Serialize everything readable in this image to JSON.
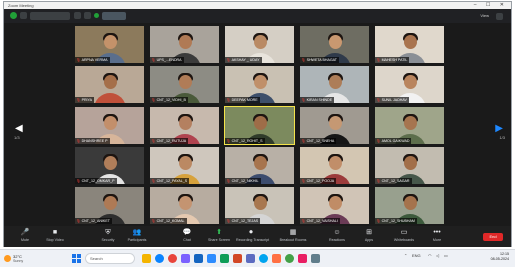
{
  "window": {
    "title": "Zoom Meeting",
    "controls": "–  ☐  ✕"
  },
  "top_bar": {
    "view_label": "View"
  },
  "pager": {
    "left_page": "1/3",
    "right_page": "1/3"
  },
  "tiles": [
    {
      "name": "ARPNA VERMA",
      "bg": "#8c7a5c",
      "skin": "#c4926a",
      "shirt": "#5a6e8c",
      "active": false
    },
    {
      "name": "UPS_...ENDRA",
      "bg": "#a9a39b",
      "skin": "#b07a55",
      "shirt": "#3b3b3b",
      "active": false
    },
    {
      "name": "AKSHAY _ UDAY",
      "bg": "#d5cfc5",
      "skin": "#b98a64",
      "shirt": "#e8e4dc",
      "active": false
    },
    {
      "name": "SHWETA BHAGAT",
      "bg": "#6e6d62",
      "skin": "#c99870",
      "shirt": "#2f3a4a",
      "active": false
    },
    {
      "name": "MAHESH PATIL",
      "bg": "#e0d8cc",
      "skin": "#a9744f",
      "shirt": "#8a8f96",
      "active": false
    },
    {
      "name": "PRIYA",
      "bg": "#b9a896",
      "skin": "#a56f4a",
      "shirt": "#c0503a",
      "active": false
    },
    {
      "name": "CNT_12_VIDHI_B",
      "bg": "#8d8c84",
      "skin": "#b07c57",
      "shirt": "#4a5a3a",
      "active": false
    },
    {
      "name": "DEEPAK MORE",
      "bg": "#c9c1b3",
      "skin": "#c0906a",
      "shirt": "#3d4f6b",
      "active": false
    },
    {
      "name": "KIRAN SHINDE",
      "bg": "#aeb5b8",
      "skin": "#ad7d58",
      "shirt": "#e6e6e6",
      "active": false
    },
    {
      "name": "SUNIL JADHAV",
      "bg": "#ddd6cb",
      "skin": "#b9855e",
      "shirt": "#f2f2f2",
      "active": false
    },
    {
      "name": "DHANSHREE P",
      "bg": "#b6a39a",
      "skin": "#c38f6b",
      "shirt": "#d7b59a",
      "active": false
    },
    {
      "name": "CNT_12_RUTUJA",
      "bg": "#c7b9ad",
      "skin": "#b48060",
      "shirt": "#b0434f",
      "active": false
    },
    {
      "name": "CNT_12_ROHIT_S",
      "bg": "#7c8a5e",
      "skin": "#9e6d48",
      "shirt": "#2f3b2a",
      "active": true
    },
    {
      "name": "CNT_12_SNEHA",
      "bg": "#a09a91",
      "skin": "#c59873",
      "shirt": "#161616",
      "active": false
    },
    {
      "name": "AMOL GAIKWAD",
      "bg": "#9fa58a",
      "skin": "#a6754f",
      "shirt": "#5d6e4c",
      "active": false
    },
    {
      "name": "CNT_12_OMKAR_P",
      "bg": "#3a3a3a",
      "skin": "#b07e5a",
      "shirt": "#e4e4e4",
      "active": false
    },
    {
      "name": "CNT_12_PAYAL_S",
      "bg": "#cfc7bd",
      "skin": "#bb8963",
      "shirt": "#d7a23c",
      "active": false
    },
    {
      "name": "CNT_12_NIKHIL",
      "bg": "#b8b0a6",
      "skin": "#a7744d",
      "shirt": "#3c4c6e",
      "active": false
    },
    {
      "name": "CNT_12_POOJA",
      "bg": "#d3c6b2",
      "skin": "#c18e69",
      "shirt": "#9c3b3b",
      "active": false
    },
    {
      "name": "CNT_12_SAGAR",
      "bg": "#c2bcb0",
      "skin": "#a26f49",
      "shirt": "#46574a",
      "active": false
    },
    {
      "name": "CNT_12_ANIKET",
      "bg": "#8a857c",
      "skin": "#ae7a55",
      "shirt": "#2e2e2e",
      "active": false
    },
    {
      "name": "CNT_12_KOMAL",
      "bg": "#b7aca0",
      "skin": "#c49471",
      "shirt": "#e5c9b0",
      "active": false
    },
    {
      "name": "CNT_12_TEJAS",
      "bg": "#c9c3b8",
      "skin": "#a8774f",
      "shirt": "#d5d5d5",
      "active": false
    },
    {
      "name": "CNT_12_VAISHALI",
      "bg": "#d0c4b6",
      "skin": "#c08c66",
      "shirt": "#6b3b56",
      "active": false
    },
    {
      "name": "CNT_12_SHUBHAM",
      "bg": "#98a08e",
      "skin": "#a5734d",
      "shirt": "#3c5a3c",
      "active": false
    }
  ],
  "controls": [
    {
      "label": "Mute",
      "icon": "🎤",
      "name": "mute-button"
    },
    {
      "label": "Stop Video",
      "icon": "■",
      "name": "stop-video-button"
    },
    {
      "label": "Security",
      "icon": "⛨",
      "name": "security-button"
    },
    {
      "label": "Participants",
      "icon": "👥",
      "name": "participants-button"
    },
    {
      "label": "Chat",
      "icon": "💬",
      "name": "chat-button"
    },
    {
      "label": "Share Screen",
      "icon": "⬆",
      "name": "share-screen-button"
    },
    {
      "label": "Recording Transcript",
      "icon": "⏺",
      "name": "record-button"
    },
    {
      "label": "Breakout Rooms",
      "icon": "▦",
      "name": "breakout-rooms-button"
    },
    {
      "label": "Reactions",
      "icon": "☺",
      "name": "reactions-button"
    },
    {
      "label": "Apps",
      "icon": "⊞",
      "name": "apps-button"
    },
    {
      "label": "Whiteboards",
      "icon": "▭",
      "name": "whiteboards-button"
    },
    {
      "label": "More",
      "icon": "•••",
      "name": "more-button"
    }
  ],
  "end_label": "End",
  "taskbar": {
    "weather_temp": "32°C",
    "weather_text": "Sunny",
    "search_placeholder": "Search",
    "lang": "ENG",
    "time": "12:15",
    "date": "08-05-2024"
  },
  "colors": {
    "meeting_bg": "#1a1a1a",
    "active_speaker": "#f3e34a",
    "end_button": "#e02828",
    "video_on": "#34c759"
  }
}
